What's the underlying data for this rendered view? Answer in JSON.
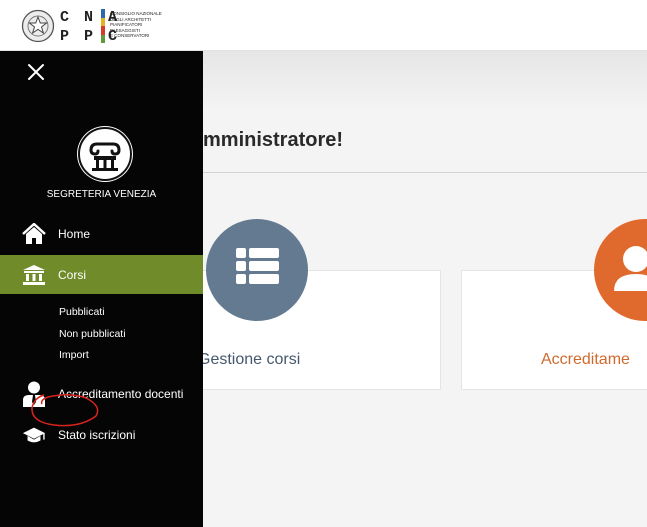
{
  "header": {
    "logo_letters_top": "C N A",
    "logo_letters_bottom": "P P C",
    "logo_fine_print": "CONSIGLIO NAZIONALE\nDEGLI ARCHITETTI\nPIANIFICATORI\nPAESAGGISTI\nE CONSERVATORI",
    "logo_bar_colors": [
      "#2c6ab0",
      "#e1b323",
      "#d8392a",
      "#5f9b3a"
    ]
  },
  "sidebar": {
    "close_icon": "close-icon",
    "avatar_icon": "column-capital-icon",
    "user_name": "SEGRETERIA VENEZIA",
    "items": [
      {
        "label": "Home",
        "icon": "home-icon"
      },
      {
        "label": "Corsi",
        "icon": "institution-icon",
        "active": true
      },
      {
        "label": "Accreditamento docenti",
        "icon": "user-tie-icon"
      },
      {
        "label": "Stato iscrizioni",
        "icon": "graduation-cap-icon"
      }
    ],
    "subitems": [
      "Pubblicati",
      "Non pubblicati",
      "Import"
    ],
    "active_color": "#6f8b2a"
  },
  "main": {
    "welcome_text": "mministratore!",
    "cards": [
      {
        "title": "Gestione corsi",
        "icon": "list-icon",
        "color": "#637a91"
      },
      {
        "title": "Accreditame",
        "icon": "user-icon",
        "color": "#e06a2d"
      }
    ]
  }
}
